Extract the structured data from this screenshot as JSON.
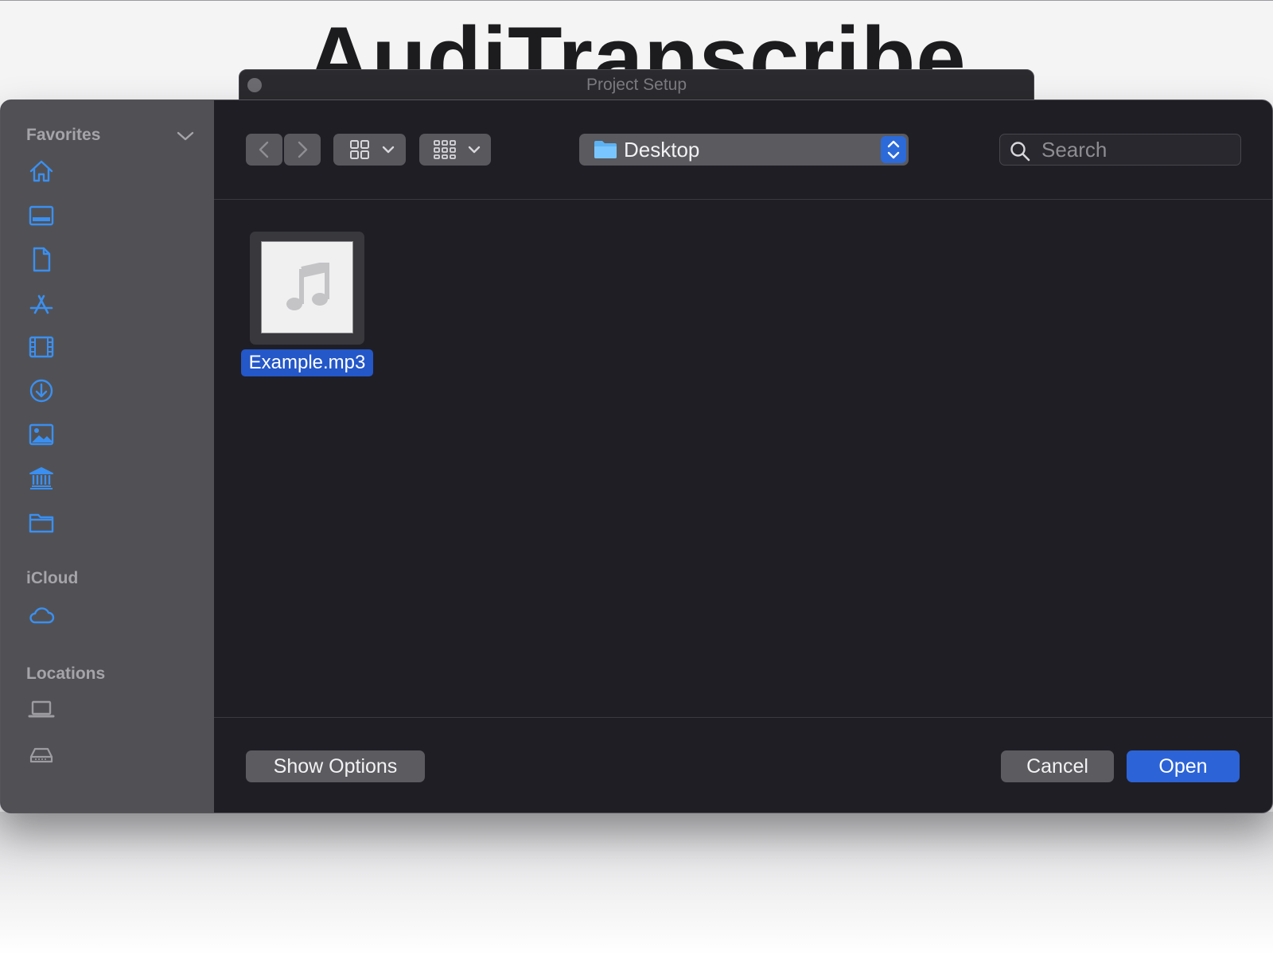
{
  "background_app": {
    "title": "AudiTranscribe",
    "window_title": "Project Setup"
  },
  "sidebar": {
    "sections": [
      {
        "label": "Favorites",
        "collapsible": true,
        "items": [
          {
            "icon": "home-icon"
          },
          {
            "icon": "desktop-icon"
          },
          {
            "icon": "documents-icon"
          },
          {
            "icon": "applications-icon"
          },
          {
            "icon": "movies-icon"
          },
          {
            "icon": "downloads-icon"
          },
          {
            "icon": "pictures-icon"
          },
          {
            "icon": "library-icon"
          },
          {
            "icon": "folder-icon"
          }
        ]
      },
      {
        "label": "iCloud",
        "items": [
          {
            "icon": "icloud-icon"
          }
        ]
      },
      {
        "label": "Locations",
        "items": [
          {
            "icon": "laptop-icon"
          },
          {
            "icon": "drive-icon"
          }
        ]
      }
    ]
  },
  "toolbar": {
    "path": "Desktop",
    "search_placeholder": "Search"
  },
  "files": [
    {
      "name": "Example.mp3",
      "type": "audio",
      "selected": true
    }
  ],
  "footer": {
    "options_label": "Show Options",
    "cancel_label": "Cancel",
    "open_label": "Open"
  },
  "colors": {
    "accent": "#2c63d7",
    "sidebar_icon": "#3b8ff0",
    "dialog_bg": "#1f1e25",
    "sidebar_bg": "#515155"
  }
}
